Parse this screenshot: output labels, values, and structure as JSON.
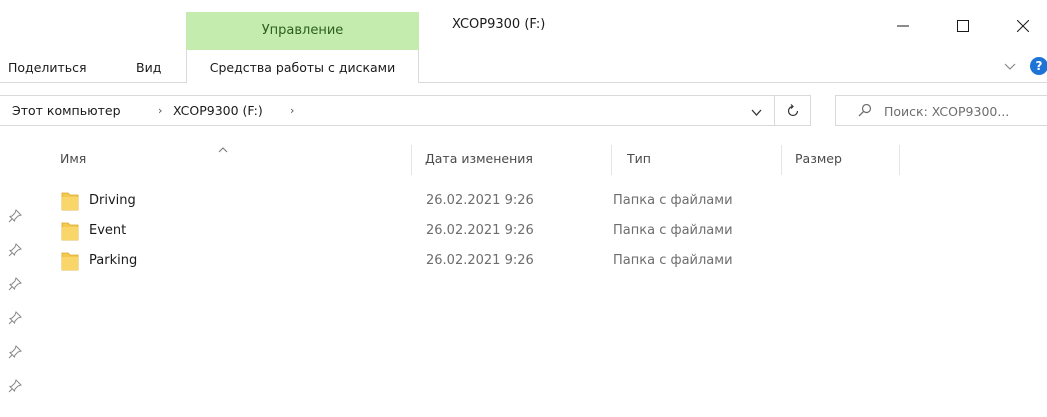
{
  "window": {
    "title": "XCOP9300 (F:)",
    "context_tab_header": "Управление"
  },
  "ribbon": {
    "tabs": [
      {
        "label": "Поделиться"
      },
      {
        "label": "Вид"
      }
    ],
    "context_tab_label": "Средства работы с дисками",
    "help_label": "?"
  },
  "address": {
    "breadcrumbs": [
      {
        "label": "Этот компьютер"
      },
      {
        "label": "XCOP9300 (F:)"
      }
    ]
  },
  "search": {
    "placeholder": "Поиск: XCOP9300..."
  },
  "columns": {
    "name": "Имя",
    "date": "Дата изменения",
    "type": "Тип",
    "size": "Размер"
  },
  "files": [
    {
      "name": "Driving",
      "date": "26.02.2021 9:26",
      "type": "Папка с файлами",
      "icon": "folder-icon"
    },
    {
      "name": "Event",
      "date": "26.02.2021 9:26",
      "type": "Папка с файлами",
      "icon": "folder-icon"
    },
    {
      "name": "Parking",
      "date": "26.02.2021 9:26",
      "type": "Папка с файлами",
      "icon": "folder-icon"
    }
  ],
  "quick_access_pins": 6,
  "colors": {
    "context_tab": "#c4ecae",
    "context_tab_text": "#2b5f1d",
    "help": "#1e73d6",
    "folder": "#f3c94f"
  }
}
